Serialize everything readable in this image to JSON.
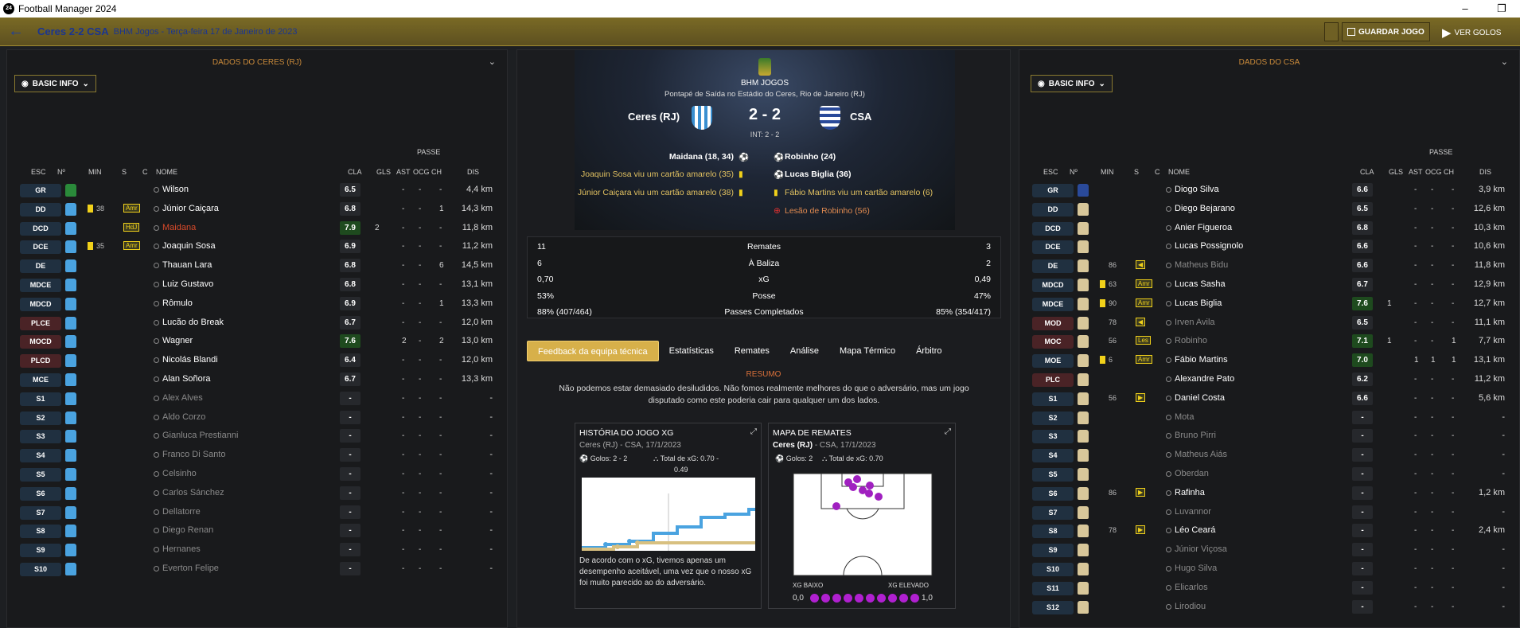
{
  "window": {
    "title": "Football Manager 2024",
    "min": "–",
    "restore": "❐",
    "close": "✕"
  },
  "topbar": {
    "score": "Ceres 2-2 CSA",
    "subtitle": "BHM Jogos - Terça-feira 17 de Janeiro de 2023",
    "save": "GUARDAR JOGO",
    "goals": "VER GOLOS"
  },
  "home": {
    "title": "DADOS DO CERES (RJ)",
    "basic": "BASIC INFO",
    "headers": {
      "esc": "ESC",
      "n": "Nº",
      "min": "MIN",
      "s": "S",
      "c": "C",
      "nome": "NOME",
      "cla": "CLA",
      "gls": "GLS",
      "ast": "AST",
      "ocg": "OCG",
      "ch": "CH",
      "dis": "DIS",
      "passe": "PASSE"
    },
    "players": [
      {
        "pos": "GR",
        "name": "Wilson",
        "cla": "6.5",
        "gls": "",
        "ast": "-",
        "ocg": "-",
        "ch": "-",
        "dis": "4,4 km",
        "min": "",
        "card": false,
        "badge": "",
        "style": "",
        "red": false,
        "g": false
      },
      {
        "pos": "DD",
        "name": "Júnior Caiçara",
        "cla": "6.8",
        "gls": "",
        "ast": "-",
        "ocg": "-",
        "ch": "1",
        "dis": "14,3 km",
        "min": "38",
        "card": true,
        "badge": "Amr",
        "style": "",
        "red": false,
        "g": false
      },
      {
        "pos": "DCD",
        "name": "Maidana",
        "cla": "7.9",
        "gls": "2",
        "ast": "-",
        "ocg": "-",
        "ch": "-",
        "dis": "11,8 km",
        "min": "",
        "card": false,
        "badge": "HdJ",
        "style": "red",
        "red": false,
        "g": true
      },
      {
        "pos": "DCE",
        "name": "Joaquin Sosa",
        "cla": "6.9",
        "gls": "",
        "ast": "-",
        "ocg": "-",
        "ch": "-",
        "dis": "11,2 km",
        "min": "35",
        "card": true,
        "badge": "Amr",
        "style": "",
        "red": false,
        "g": false
      },
      {
        "pos": "DE",
        "name": "Thauan Lara",
        "cla": "6.8",
        "gls": "",
        "ast": "-",
        "ocg": "-",
        "ch": "6",
        "dis": "14,5 km",
        "min": "",
        "card": false,
        "badge": "",
        "style": "",
        "red": false,
        "g": false
      },
      {
        "pos": "MDCE",
        "name": "Luiz Gustavo",
        "cla": "6.8",
        "gls": "",
        "ast": "-",
        "ocg": "-",
        "ch": "-",
        "dis": "13,1 km",
        "min": "",
        "card": false,
        "badge": "",
        "style": "",
        "red": false,
        "g": false
      },
      {
        "pos": "MDCD",
        "name": "Rômulo",
        "cla": "6.9",
        "gls": "",
        "ast": "-",
        "ocg": "-",
        "ch": "1",
        "dis": "13,3 km",
        "min": "",
        "card": false,
        "badge": "",
        "style": "",
        "red": false,
        "g": false
      },
      {
        "pos": "PLCE",
        "name": "Lucão do Break",
        "cla": "6.7",
        "gls": "",
        "ast": "-",
        "ocg": "-",
        "ch": "-",
        "dis": "12,0 km",
        "min": "",
        "card": false,
        "badge": "",
        "style": "",
        "red": true,
        "g": false
      },
      {
        "pos": "MOCD",
        "name": "Wagner",
        "cla": "7.6",
        "gls": "",
        "ast": "2",
        "ocg": "-",
        "ch": "2",
        "dis": "13,0 km",
        "min": "",
        "card": false,
        "badge": "",
        "style": "",
        "red": true,
        "g": true
      },
      {
        "pos": "PLCD",
        "name": "Nicolás Blandi",
        "cla": "6.4",
        "gls": "",
        "ast": "-",
        "ocg": "-",
        "ch": "-",
        "dis": "12,0 km",
        "min": "",
        "card": false,
        "badge": "",
        "style": "",
        "red": true,
        "g": false
      },
      {
        "pos": "MCE",
        "name": "Alan Soñora",
        "cla": "6.7",
        "gls": "",
        "ast": "-",
        "ocg": "-",
        "ch": "-",
        "dis": "13,3 km",
        "min": "",
        "card": false,
        "badge": "",
        "style": "",
        "red": false,
        "g": false
      },
      {
        "pos": "S1",
        "name": "Alex Alves",
        "cla": "-",
        "gls": "",
        "ast": "-",
        "ocg": "-",
        "ch": "-",
        "dis": "-",
        "min": "",
        "card": false,
        "badge": "",
        "style": "dim",
        "red": false,
        "g": false
      },
      {
        "pos": "S2",
        "name": "Aldo Corzo",
        "cla": "-",
        "gls": "",
        "ast": "-",
        "ocg": "-",
        "ch": "-",
        "dis": "-",
        "min": "",
        "card": false,
        "badge": "",
        "style": "dim",
        "red": false,
        "g": false
      },
      {
        "pos": "S3",
        "name": "Gianluca Prestianni",
        "cla": "-",
        "gls": "",
        "ast": "-",
        "ocg": "-",
        "ch": "-",
        "dis": "-",
        "min": "",
        "card": false,
        "badge": "",
        "style": "dim",
        "red": false,
        "g": false
      },
      {
        "pos": "S4",
        "name": "Franco Di Santo",
        "cla": "-",
        "gls": "",
        "ast": "-",
        "ocg": "-",
        "ch": "-",
        "dis": "-",
        "min": "",
        "card": false,
        "badge": "",
        "style": "dim",
        "red": false,
        "g": false
      },
      {
        "pos": "S5",
        "name": "Celsinho",
        "cla": "-",
        "gls": "",
        "ast": "-",
        "ocg": "-",
        "ch": "-",
        "dis": "-",
        "min": "",
        "card": false,
        "badge": "",
        "style": "dim",
        "red": false,
        "g": false
      },
      {
        "pos": "S6",
        "name": "Carlos Sánchez",
        "cla": "-",
        "gls": "",
        "ast": "-",
        "ocg": "-",
        "ch": "-",
        "dis": "-",
        "min": "",
        "card": false,
        "badge": "",
        "style": "dim",
        "red": false,
        "g": false
      },
      {
        "pos": "S7",
        "name": "Dellatorre",
        "cla": "-",
        "gls": "",
        "ast": "-",
        "ocg": "-",
        "ch": "-",
        "dis": "-",
        "min": "",
        "card": false,
        "badge": "",
        "style": "dim",
        "red": false,
        "g": false
      },
      {
        "pos": "S8",
        "name": "Diego Renan",
        "cla": "-",
        "gls": "",
        "ast": "-",
        "ocg": "-",
        "ch": "-",
        "dis": "-",
        "min": "",
        "card": false,
        "badge": "",
        "style": "dim",
        "red": false,
        "g": false
      },
      {
        "pos": "S9",
        "name": "Hernanes",
        "cla": "-",
        "gls": "",
        "ast": "-",
        "ocg": "-",
        "ch": "-",
        "dis": "-",
        "min": "",
        "card": false,
        "badge": "",
        "style": "dim",
        "red": false,
        "g": false
      },
      {
        "pos": "S10",
        "name": "Everton Felipe",
        "cla": "-",
        "gls": "",
        "ast": "-",
        "ocg": "-",
        "ch": "-",
        "dis": "-",
        "min": "",
        "card": false,
        "badge": "",
        "style": "dim",
        "red": false,
        "g": false
      }
    ]
  },
  "away": {
    "title": "DADOS DO CSA",
    "basic": "BASIC INFO",
    "players": [
      {
        "pos": "GR",
        "name": "Diogo Silva",
        "cla": "6.6",
        "gls": "",
        "ast": "-",
        "ocg": "-",
        "ch": "-",
        "dis": "3,9 km",
        "min": "",
        "card": false,
        "badge": "",
        "style": "",
        "red": false,
        "g": false
      },
      {
        "pos": "DD",
        "name": "Diego Bejarano",
        "cla": "6.5",
        "gls": "",
        "ast": "-",
        "ocg": "-",
        "ch": "-",
        "dis": "12,6 km",
        "min": "",
        "card": false,
        "badge": "",
        "style": "",
        "red": false,
        "g": false
      },
      {
        "pos": "DCD",
        "name": "Anier Figueroa",
        "cla": "6.8",
        "gls": "",
        "ast": "-",
        "ocg": "-",
        "ch": "-",
        "dis": "10,3 km",
        "min": "",
        "card": false,
        "badge": "",
        "style": "",
        "red": false,
        "g": false
      },
      {
        "pos": "DCE",
        "name": "Lucas Possignolo",
        "cla": "6.6",
        "gls": "",
        "ast": "-",
        "ocg": "-",
        "ch": "-",
        "dis": "10,6 km",
        "min": "",
        "card": false,
        "badge": "",
        "style": "",
        "red": false,
        "g": false
      },
      {
        "pos": "DE",
        "name": "Matheus Bidu",
        "cla": "6.6",
        "gls": "",
        "ast": "-",
        "ocg": "-",
        "ch": "-",
        "dis": "11,8 km",
        "min": "86",
        "card": false,
        "badge": "◀",
        "style": "dim",
        "red": false,
        "g": false
      },
      {
        "pos": "MDCD",
        "name": "Lucas Sasha",
        "cla": "6.7",
        "gls": "",
        "ast": "-",
        "ocg": "-",
        "ch": "-",
        "dis": "12,9 km",
        "min": "63",
        "card": true,
        "badge": "Amr",
        "style": "",
        "red": false,
        "g": false
      },
      {
        "pos": "MDCE",
        "name": "Lucas Biglia",
        "cla": "7.6",
        "gls": "1",
        "ast": "-",
        "ocg": "-",
        "ch": "-",
        "dis": "12,7 km",
        "min": "90",
        "card": true,
        "badge": "Amr",
        "style": "",
        "red": false,
        "g": true
      },
      {
        "pos": "MOD",
        "name": "Irven Avila",
        "cla": "6.5",
        "gls": "",
        "ast": "-",
        "ocg": "-",
        "ch": "-",
        "dis": "11,1 km",
        "min": "78",
        "card": false,
        "badge": "◀",
        "style": "dim",
        "red": true,
        "g": false
      },
      {
        "pos": "MOC",
        "name": "Robinho",
        "cla": "7.1",
        "gls": "1",
        "ast": "-",
        "ocg": "-",
        "ch": "1",
        "dis": "7,7 km",
        "min": "56",
        "card": false,
        "badge": "Les",
        "style": "dim",
        "red": true,
        "g": true
      },
      {
        "pos": "MOE",
        "name": "Fábio Martins",
        "cla": "7.0",
        "gls": "",
        "ast": "1",
        "ocg": "1",
        "ch": "1",
        "dis": "13,1 km",
        "min": "6",
        "card": true,
        "badge": "Amr",
        "style": "",
        "red": false,
        "g": true
      },
      {
        "pos": "PLC",
        "name": "Alexandre Pato",
        "cla": "6.2",
        "gls": "",
        "ast": "-",
        "ocg": "-",
        "ch": "-",
        "dis": "11,2 km",
        "min": "",
        "card": false,
        "badge": "",
        "style": "",
        "red": true,
        "g": false
      },
      {
        "pos": "S1",
        "name": "Daniel Costa",
        "cla": "6.6",
        "gls": "",
        "ast": "-",
        "ocg": "-",
        "ch": "-",
        "dis": "5,6 km",
        "min": "56",
        "card": false,
        "badge": "▶",
        "style": "",
        "red": false,
        "g": false
      },
      {
        "pos": "S2",
        "name": "Mota",
        "cla": "-",
        "gls": "",
        "ast": "-",
        "ocg": "-",
        "ch": "-",
        "dis": "-",
        "min": "",
        "card": false,
        "badge": "",
        "style": "dim",
        "red": false,
        "g": false
      },
      {
        "pos": "S3",
        "name": "Bruno Pirri",
        "cla": "-",
        "gls": "",
        "ast": "-",
        "ocg": "-",
        "ch": "-",
        "dis": "-",
        "min": "",
        "card": false,
        "badge": "",
        "style": "dim",
        "red": false,
        "g": false
      },
      {
        "pos": "S4",
        "name": "Matheus Aiás",
        "cla": "-",
        "gls": "",
        "ast": "-",
        "ocg": "-",
        "ch": "-",
        "dis": "-",
        "min": "",
        "card": false,
        "badge": "",
        "style": "dim",
        "red": false,
        "g": false
      },
      {
        "pos": "S5",
        "name": "Oberdan",
        "cla": "-",
        "gls": "",
        "ast": "-",
        "ocg": "-",
        "ch": "-",
        "dis": "-",
        "min": "",
        "card": false,
        "badge": "",
        "style": "dim",
        "red": false,
        "g": false
      },
      {
        "pos": "S6",
        "name": "Rafinha",
        "cla": "-",
        "gls": "",
        "ast": "-",
        "ocg": "-",
        "ch": "-",
        "dis": "1,2 km",
        "min": "86",
        "card": false,
        "badge": "▶",
        "style": "",
        "red": false,
        "g": false
      },
      {
        "pos": "S7",
        "name": "Luvannor",
        "cla": "-",
        "gls": "",
        "ast": "-",
        "ocg": "-",
        "ch": "-",
        "dis": "-",
        "min": "",
        "card": false,
        "badge": "",
        "style": "dim",
        "red": false,
        "g": false
      },
      {
        "pos": "S8",
        "name": "Léo Ceará",
        "cla": "-",
        "gls": "",
        "ast": "-",
        "ocg": "-",
        "ch": "-",
        "dis": "2,4 km",
        "min": "78",
        "card": false,
        "badge": "▶",
        "style": "",
        "red": false,
        "g": false
      },
      {
        "pos": "S9",
        "name": "Júnior Viçosa",
        "cla": "-",
        "gls": "",
        "ast": "-",
        "ocg": "-",
        "ch": "-",
        "dis": "-",
        "min": "",
        "card": false,
        "badge": "",
        "style": "dim",
        "red": false,
        "g": false
      },
      {
        "pos": "S10",
        "name": "Hugo Silva",
        "cla": "-",
        "gls": "",
        "ast": "-",
        "ocg": "-",
        "ch": "-",
        "dis": "-",
        "min": "",
        "card": false,
        "badge": "",
        "style": "dim",
        "red": false,
        "g": false
      },
      {
        "pos": "S11",
        "name": "Elicarlos",
        "cla": "-",
        "gls": "",
        "ast": "-",
        "ocg": "-",
        "ch": "-",
        "dis": "-",
        "min": "",
        "card": false,
        "badge": "",
        "style": "dim",
        "red": false,
        "g": false
      },
      {
        "pos": "S12",
        "name": "Lirodiou",
        "cla": "-",
        "gls": "",
        "ast": "-",
        "ocg": "-",
        "ch": "-",
        "dis": "-",
        "min": "",
        "card": false,
        "badge": "",
        "style": "dim",
        "red": false,
        "g": false
      }
    ]
  },
  "match": {
    "comp": "BHM JOGOS",
    "kickoff": "Pontapé de Saída no Estádio do Ceres, Rio de Janeiro (RJ)",
    "home": "Ceres (RJ)",
    "away": "CSA",
    "score": "2 - 2",
    "int": "INT: 2 - 2",
    "homeEvents": [
      "Maidana (18, 34)",
      "Joaquin Sosa viu um cartão amarelo (35)",
      "Júnior Caiçara viu um cartão amarelo (38)"
    ],
    "awayEvents": [
      "Robinho (24)",
      "Lucas Biglia (36)",
      "Fábio Martins viu um cartão amarelo (6)",
      "Lesão de Robinho (56)"
    ]
  },
  "stats": [
    {
      "h": "11",
      "label": "Remates",
      "a": "3"
    },
    {
      "h": "6",
      "label": "À Baliza",
      "a": "2"
    },
    {
      "h": "0,70",
      "label": "xG",
      "a": "0,49"
    },
    {
      "h": "53%",
      "label": "Posse",
      "a": "47%"
    },
    {
      "h": "88% (407/464)",
      "label": "Passes Completados",
      "a": "85% (354/417)"
    }
  ],
  "tabs": [
    "Feedback da equipa técnica",
    "Estatísticas",
    "Remates",
    "Análise",
    "Mapa Térmico",
    "Árbitro"
  ],
  "resumo": {
    "title": "RESUMO",
    "text": "Não podemos estar demasiado desiludidos. Não fomos realmente melhores do que o adversário, mas um jogo disputado como este poderia cair para qualquer um dos lados."
  },
  "xgcard": {
    "title": "HISTÓRIA DO JOGO XG",
    "sub": "Ceres (RJ) - CSA, 17/1/2023",
    "goals": "Golos: 2 - 2",
    "xgtot": "Total de xG: 0.70 -",
    "xgtot2": "0.49",
    "text": "De acordo com o xG, tivemos apenas um desempenho aceitável, uma vez que o nosso xG foi muito parecido ao do adversário."
  },
  "shotcard": {
    "title": "MAPA DE REMATES",
    "team": "Ceres (RJ)",
    "sub": "- CSA, 17/1/2023",
    "goals": "Golos: 2",
    "xgtot": "Total de xG: 0.70",
    "low": "XG BAIXO",
    "high": "XG ELEVADO",
    "min": "0,0",
    "max": "1,0"
  }
}
